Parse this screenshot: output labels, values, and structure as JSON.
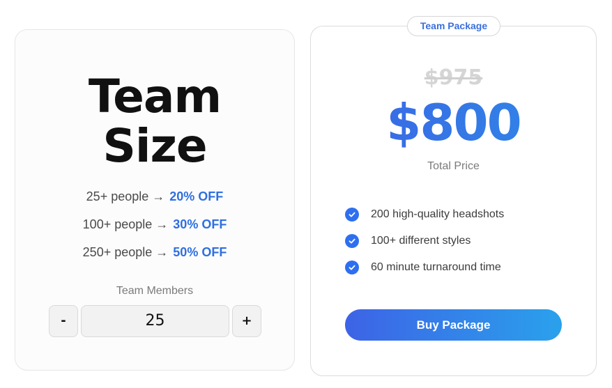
{
  "team_size": {
    "title_line1": "Team",
    "title_line2": "Size",
    "tiers": [
      {
        "text": "25+ people →",
        "discount": "20% OFF"
      },
      {
        "text": "100+ people →",
        "discount": "30% OFF"
      },
      {
        "text": "250+ people →",
        "discount": "50% OFF"
      }
    ],
    "members_label": "Team Members",
    "stepper": {
      "minus_label": "-",
      "value": "25",
      "plus_label": "+"
    }
  },
  "package": {
    "badge": "Team Package",
    "old_price": "$975",
    "price": "$800",
    "price_caption": "Total Price",
    "features": [
      {
        "text": "200 high-quality headshots",
        "icon": "check-icon"
      },
      {
        "text": "100+ different styles",
        "icon": "check-icon"
      },
      {
        "text": "60 minute turnaround time",
        "icon": "check-icon"
      }
    ],
    "buy_label": "Buy Package"
  },
  "colors": {
    "accent": "#2f6fe0",
    "gradient_start": "#3d63e6",
    "gradient_end": "#2aa1ec",
    "check_bg": "#2e6ff0"
  }
}
